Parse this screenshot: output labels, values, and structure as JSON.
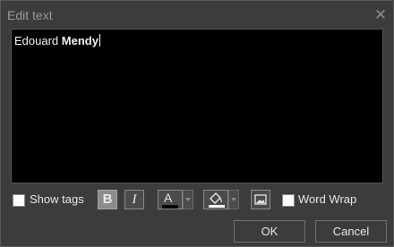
{
  "window": {
    "title": "Edit text",
    "close_icon": "close-icon"
  },
  "editor": {
    "text_regular": "Edouard ",
    "text_bold": "Mendy"
  },
  "options": {
    "show_tags_label": "Show tags",
    "show_tags_checked": false,
    "word_wrap_label": "Word Wrap",
    "word_wrap_checked": false
  },
  "toolbar": {
    "bold_label": "B",
    "italic_label": "I",
    "font_color_glyph": "A",
    "font_color": "#000000",
    "fill_color": "#ffffff",
    "bold_active": true
  },
  "buttons": {
    "ok_label": "OK",
    "cancel_label": "Cancel"
  }
}
